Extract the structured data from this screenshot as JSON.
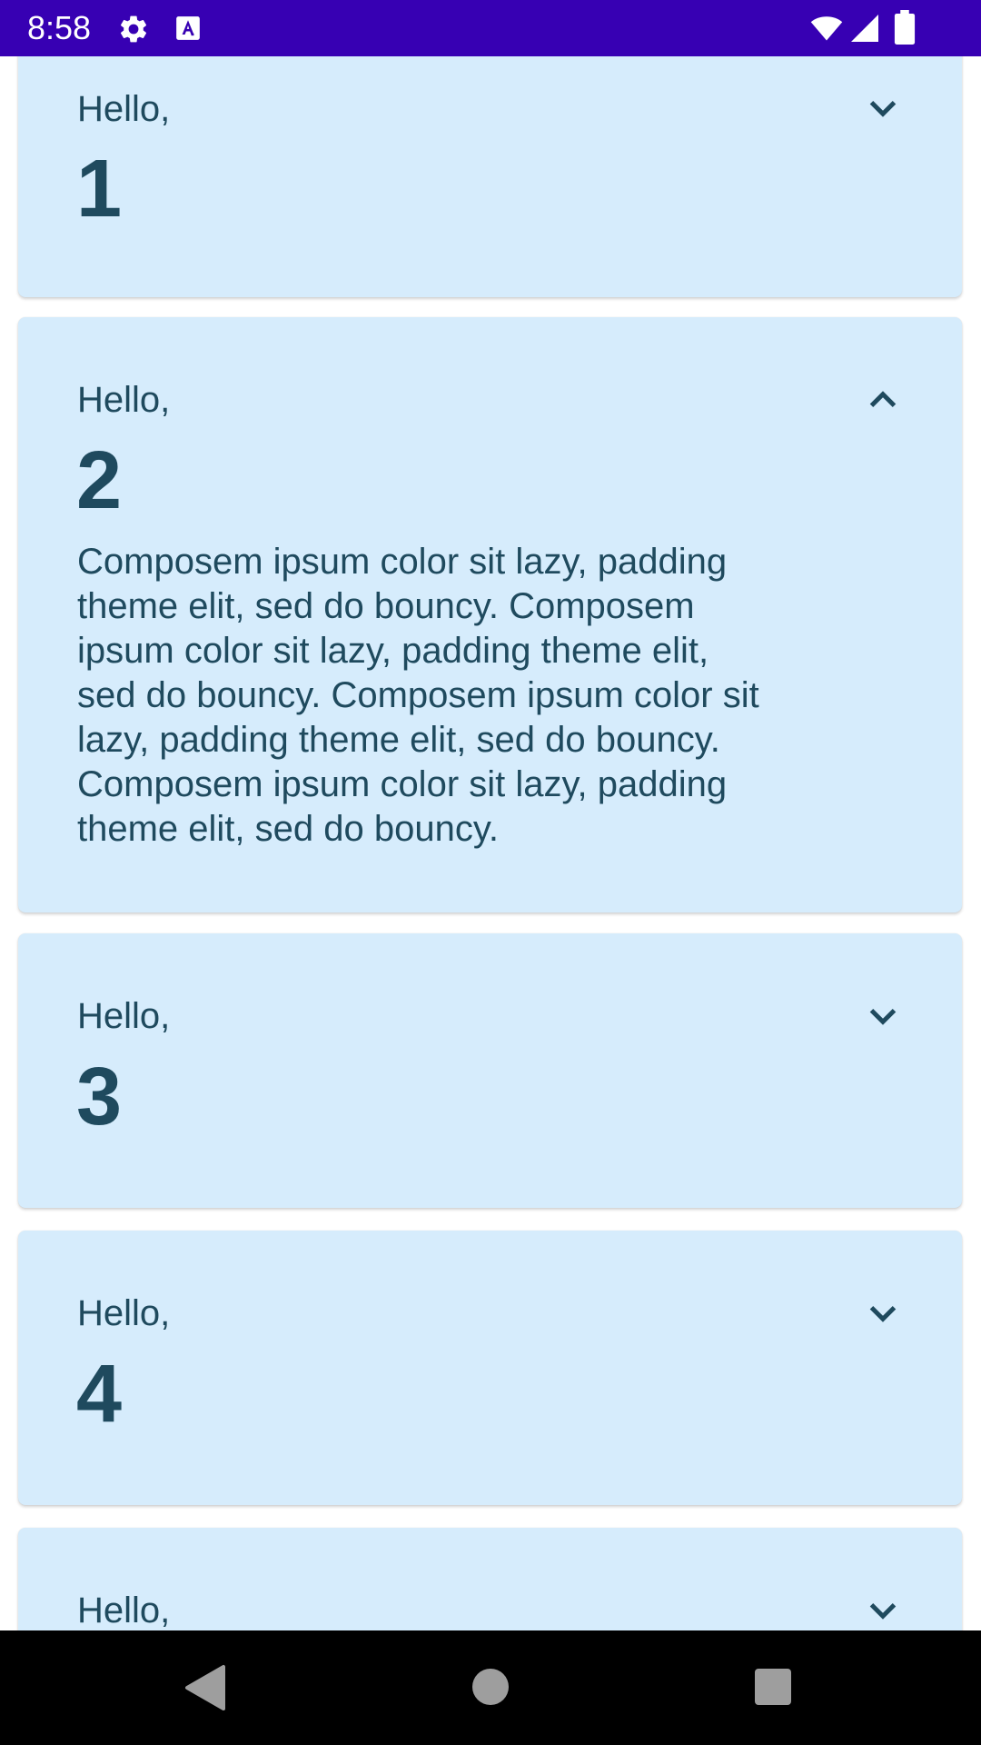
{
  "status_bar": {
    "time": "8:58",
    "icons": [
      "gear-icon",
      "a-icon",
      "wifi-icon",
      "signal-icon",
      "battery-icon"
    ],
    "background": "#3700b3"
  },
  "cards": [
    {
      "greeting": "Hello,",
      "number": "1",
      "expanded": false
    },
    {
      "greeting": "Hello,",
      "number": "2",
      "expanded": true,
      "body": "Composem ipsum color sit lazy, padding theme elit, sed do bouncy. Composem ipsum color sit lazy, padding theme elit, sed do bouncy. Composem ipsum color sit lazy, padding theme elit, sed do bouncy. Composem ipsum color sit lazy, padding theme elit, sed do bouncy."
    },
    {
      "greeting": "Hello,",
      "number": "3",
      "expanded": false
    },
    {
      "greeting": "Hello,",
      "number": "4",
      "expanded": false
    },
    {
      "greeting": "Hello,",
      "number": "",
      "expanded": false
    }
  ],
  "colors": {
    "card_background": "#d6ecfc",
    "text": "#1f4a5e",
    "nav_background": "#000000"
  },
  "nav_bar": {
    "icons": [
      "back-icon",
      "home-icon",
      "recents-icon"
    ]
  }
}
